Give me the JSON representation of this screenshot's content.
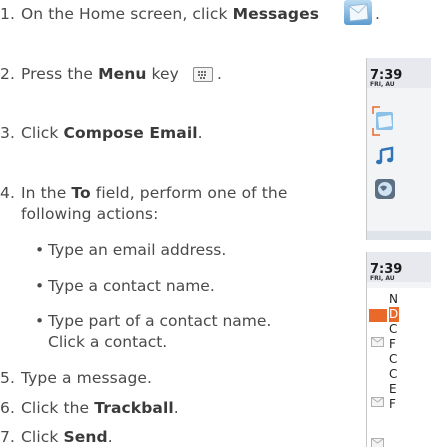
{
  "instructions": {
    "steps": [
      {
        "num": "1.",
        "pre": "On the Home screen, click ",
        "bold": "Messages",
        "post": ""
      },
      {
        "num": "2.",
        "pre": "Press the ",
        "bold": "Menu",
        "post": " key"
      },
      {
        "num": "3.",
        "pre": "Click ",
        "bold": "Compose Email",
        "post": "."
      },
      {
        "num": "4.",
        "pre": "In the ",
        "bold": "To",
        "post": " field, perform one of the",
        "line2": "following actions:"
      },
      {
        "num": "5.",
        "pre": "Type a message.",
        "bold": "",
        "post": ""
      },
      {
        "num": "6.",
        "pre": "Click the ",
        "bold": "Trackball",
        "post": "."
      },
      {
        "num": "7.",
        "pre": "Click ",
        "bold": "Send",
        "post": "."
      }
    ],
    "step1_trailing": ".",
    "step2_trailing": ".",
    "sub_actions": [
      {
        "bullet": "•",
        "text": "Type an email address."
      },
      {
        "bullet": "•",
        "text": "Type a contact name."
      },
      {
        "bullet": "•",
        "text": "Type part of a contact name.",
        "line2": "Click a contact."
      }
    ]
  },
  "phone_screens": [
    {
      "clock": "7:39",
      "date": "FRI, AU"
    },
    {
      "clock": "7:39",
      "date": "FRI, AU",
      "list_letters": [
        "N",
        "D",
        "C",
        "F",
        "C",
        "C",
        "E",
        "F"
      ]
    }
  ],
  "icons": {
    "messages": "envelope-icon",
    "menu_key": "blackberry-menu-key-icon"
  },
  "colors": {
    "text": "#4a4a4a",
    "highlight": "#e8692a",
    "envelope": "#6aa7d8"
  }
}
